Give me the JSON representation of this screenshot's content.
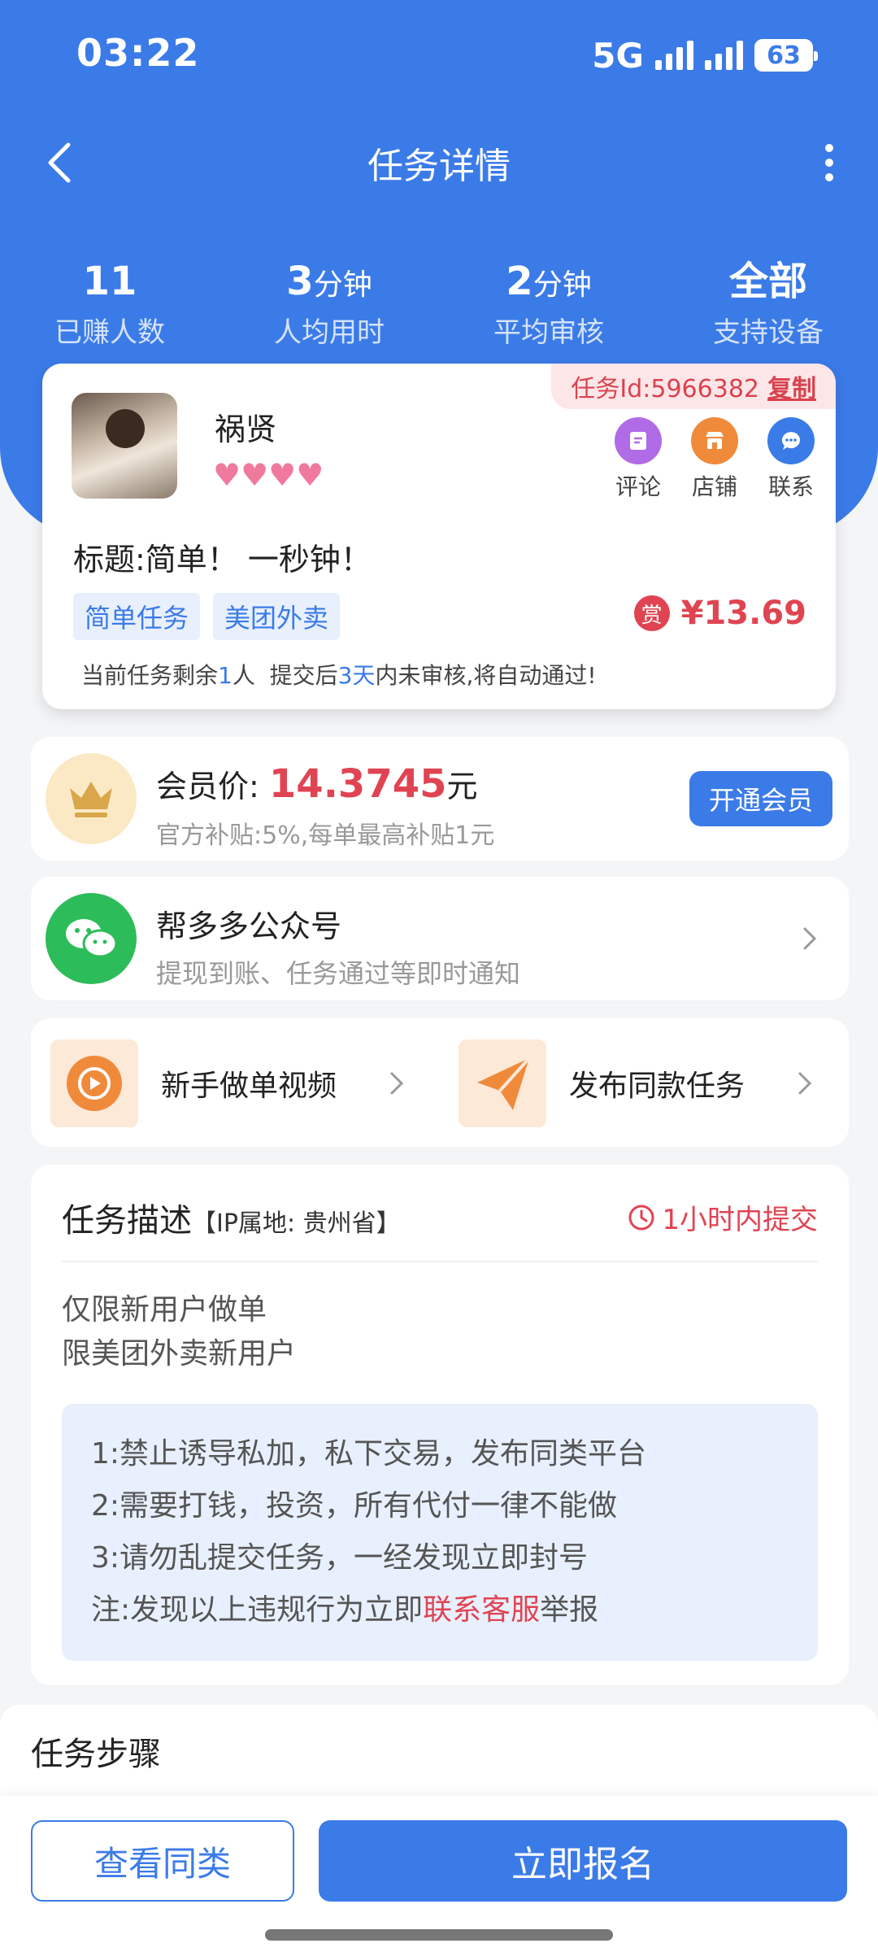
{
  "status_bar": {
    "time": "03:22",
    "network": "5G",
    "battery": "63"
  },
  "nav": {
    "title": "任务详情"
  },
  "stats": [
    {
      "value": "11",
      "unit": "",
      "label": "已赚人数"
    },
    {
      "value": "3",
      "unit": "分钟",
      "label": "人均用时"
    },
    {
      "value": "2",
      "unit": "分钟",
      "label": "平均审核"
    },
    {
      "value": "全部",
      "unit": "",
      "label": "支持设备"
    }
  ],
  "task": {
    "id_prefix": "任务Id:5966382",
    "copy_label": "复制",
    "username": "祸贤",
    "hearts": "♥♥♥♥",
    "actions": [
      {
        "label": "评论",
        "color": "#b06be6",
        "icon": "comment-icon"
      },
      {
        "label": "店铺",
        "color": "#f08a3b",
        "icon": "shop-icon"
      },
      {
        "label": "联系",
        "color": "#3b7be8",
        "icon": "chat-icon"
      }
    ],
    "title": "标题:简单！ 一秒钟！",
    "tags": [
      "简单任务",
      "美团外卖"
    ],
    "reward_badge": "赏",
    "reward": "¥13.69",
    "remain_prefix": "当前任务剩余",
    "remain_count": "1",
    "remain_mid": "人  提交后",
    "remain_days": "3天",
    "remain_suffix": "内未审核,将自动通过!"
  },
  "vip": {
    "label": "会员价: ",
    "price": "14.3745",
    "unit": "元",
    "sub": "官方补贴:5%,每单最高补贴1元",
    "button": "开通会员"
  },
  "wechat": {
    "title": "帮多多公众号",
    "sub": "提现到账、任务通过等即时通知"
  },
  "quick": [
    {
      "label": "新手做单视频"
    },
    {
      "label": "发布同款任务"
    }
  ],
  "description": {
    "title": "任务描述",
    "ip": "【IP属地: 贵州省】",
    "deadline": "1小时内提交",
    "body_line1": "仅限新用户做单",
    "body_line2": "限美团外卖新用户",
    "rule1": "1:禁止诱导私加，私下交易，发布同类平台",
    "rule2": "2:需要打钱，投资，所有代付一律不能做",
    "rule3": "3:请勿乱提交任务，一经发现立即封号",
    "rule4_prefix": "注:发现以上违规行为立即",
    "rule4_link": "联系客服",
    "rule4_suffix": "举报"
  },
  "steps": {
    "title": "任务步骤"
  },
  "bottom": {
    "similar": "查看同类",
    "signup": "立即报名"
  }
}
